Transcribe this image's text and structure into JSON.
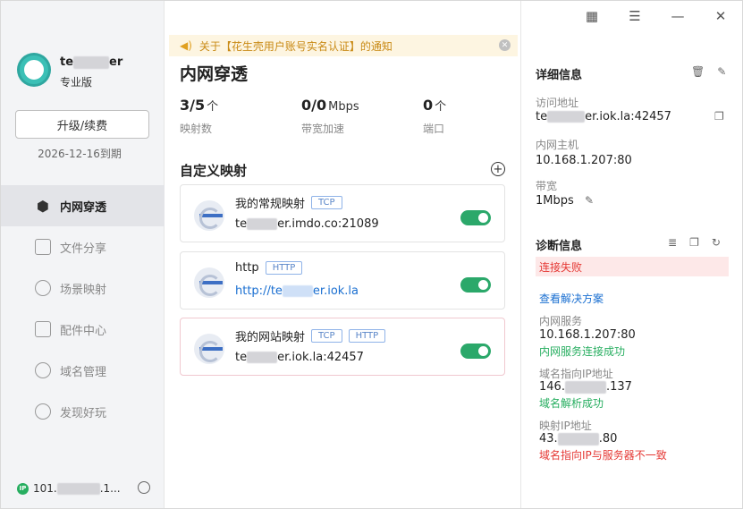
{
  "sidebar": {
    "username_prefix": "te",
    "username_suffix": "er",
    "edition": "专业版",
    "upgrade_label": "升级/续费",
    "expire": "2026-12-16到期",
    "items": [
      {
        "label": "内网穿透",
        "icon": "cube-icon"
      },
      {
        "label": "文件分享",
        "icon": "folder-share-icon"
      },
      {
        "label": "场景映射",
        "icon": "layers-icon"
      },
      {
        "label": "配件中心",
        "icon": "grid-icon"
      },
      {
        "label": "域名管理",
        "icon": "globe-icon"
      },
      {
        "label": "发现好玩",
        "icon": "compass-icon"
      }
    ],
    "ip_prefix": "101.",
    "ip_suffix": ".1...",
    "ip_badge": "IP"
  },
  "notice": {
    "text": "关于【花生壳用户账号实名认证】的通知"
  },
  "main": {
    "title": "内网穿透",
    "stats": [
      {
        "value": "3/5",
        "unit": "个",
        "label": "映射数"
      },
      {
        "value": "0/0",
        "unit": "Mbps",
        "label": "带宽加速"
      },
      {
        "value": "0",
        "unit": "个",
        "label": "端口"
      }
    ],
    "section_title": "自定义映射",
    "mappings": [
      {
        "name": "我的常规映射",
        "tags": [
          "TCP"
        ],
        "addr_prefix": "te",
        "addr_suffix": "er.imdo.co:21089",
        "enabled": true
      },
      {
        "name": "http",
        "tags": [
          "HTTP"
        ],
        "addr_prefix": "http://te",
        "addr_suffix": "er.iok.la",
        "enabled": true
      },
      {
        "name": "我的网站映射",
        "tags": [
          "TCP",
          "HTTP"
        ],
        "addr_prefix": "te",
        "addr_suffix": "er.iok.la:42457",
        "enabled": true
      }
    ]
  },
  "detail": {
    "title": "详细信息",
    "access_label": "访问地址",
    "access_prefix": "te",
    "access_suffix": "er.iok.la:42457",
    "host_label": "内网主机",
    "host_value": "10.168.1.207:80",
    "bandwidth_label": "带宽",
    "bandwidth_value": "1Mbps"
  },
  "diagnosis": {
    "title": "诊断信息",
    "status": "连接失败",
    "solution": "查看解决方案",
    "service_label": "内网服务",
    "service_value": "10.168.1.207:80",
    "service_status": "内网服务连接成功",
    "domain_ip_label": "域名指向IP地址",
    "domain_ip_prefix": "146.",
    "domain_ip_suffix": ".137",
    "domain_ip_status": "域名解析成功",
    "map_ip_label": "映射IP地址",
    "map_ip_prefix": "43.",
    "map_ip_suffix": ".80",
    "map_ip_status": "域名指向IP与服务器不一致"
  }
}
